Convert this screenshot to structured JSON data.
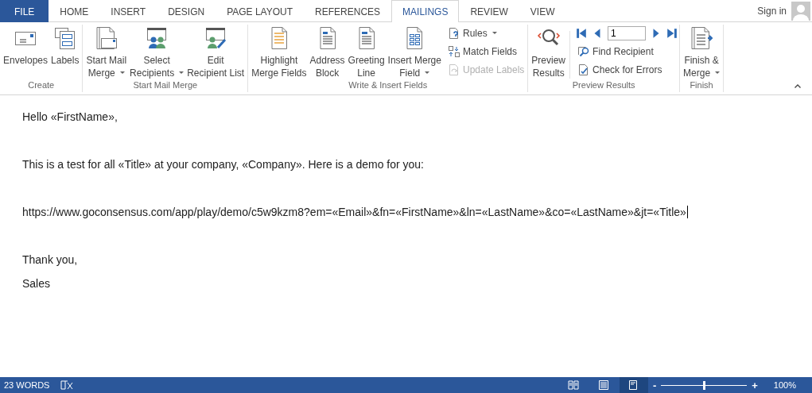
{
  "tabs": [
    {
      "label": "FILE",
      "kind": "file",
      "selected": false
    },
    {
      "label": "HOME",
      "kind": "tab",
      "selected": false
    },
    {
      "label": "INSERT",
      "kind": "tab",
      "selected": false
    },
    {
      "label": "DESIGN",
      "kind": "tab",
      "selected": false
    },
    {
      "label": "PAGE LAYOUT",
      "kind": "tab",
      "selected": false
    },
    {
      "label": "REFERENCES",
      "kind": "tab",
      "selected": false
    },
    {
      "label": "MAILINGS",
      "kind": "tab",
      "selected": true
    },
    {
      "label": "REVIEW",
      "kind": "tab",
      "selected": false
    },
    {
      "label": "VIEW",
      "kind": "tab",
      "selected": false
    }
  ],
  "account": {
    "label": "Sign in"
  },
  "ribbon": {
    "groups": [
      {
        "label": "Create",
        "buttons": [
          {
            "lines": [
              "Envelopes"
            ],
            "dropdown": false
          },
          {
            "lines": [
              "Labels"
            ],
            "dropdown": false
          }
        ]
      },
      {
        "label": "Start Mail Merge",
        "buttons": [
          {
            "lines": [
              "Start Mail",
              "Merge"
            ],
            "dropdown": true
          },
          {
            "lines": [
              "Select",
              "Recipients"
            ],
            "dropdown": true
          },
          {
            "lines": [
              "Edit",
              "Recipient List"
            ],
            "dropdown": false
          }
        ]
      },
      {
        "label": "Write & Insert Fields",
        "buttons": [
          {
            "lines": [
              "Highlight",
              "Merge Fields"
            ],
            "dropdown": false
          },
          {
            "lines": [
              "Address",
              "Block"
            ],
            "dropdown": false
          },
          {
            "lines": [
              "Greeting",
              "Line"
            ],
            "dropdown": false
          },
          {
            "lines": [
              "Insert Merge",
              "Field"
            ],
            "dropdown": true
          }
        ],
        "small": [
          {
            "label": "Rules",
            "dropdown": true,
            "disabled": false
          },
          {
            "label": "Match Fields",
            "dropdown": false,
            "disabled": false
          },
          {
            "label": "Update Labels",
            "dropdown": false,
            "disabled": true
          }
        ]
      },
      {
        "label": "Preview Results",
        "buttons": [
          {
            "lines": [
              "Preview",
              "Results"
            ],
            "dropdown": false
          }
        ],
        "record": "1",
        "small": [
          {
            "label": "Find Recipient",
            "dropdown": false,
            "disabled": false
          },
          {
            "label": "Check for Errors",
            "dropdown": false,
            "disabled": false
          }
        ]
      },
      {
        "label": "Finish",
        "buttons": [
          {
            "lines": [
              "Finish &",
              "Merge"
            ],
            "dropdown": true
          }
        ]
      }
    ]
  },
  "document": {
    "paragraphs": [
      {
        "text": "Hello «FirstName»,",
        "cursor": false
      },
      {
        "text": "This is a test for all «Title» at your company, «Company». Here is a demo for you:",
        "cursor": false
      },
      {
        "text": "https://www.goconsensus.com/app/play/demo/c5w9kzm8?em=«Email»&fn=«FirstName»&ln=«LastName»&co=«LastName»&jt=«Title»",
        "cursor": true
      },
      {
        "text": "Thank you,",
        "cursor": false
      },
      {
        "text": "Sales",
        "cursor": false
      }
    ]
  },
  "status_bar": {
    "word_count": "23 WORDS",
    "views": [
      {
        "selected": false
      },
      {
        "selected": false
      },
      {
        "selected": true
      }
    ],
    "zoom": {
      "minus": "-",
      "plus": "+",
      "level": 0.5,
      "reading": "100%"
    }
  }
}
